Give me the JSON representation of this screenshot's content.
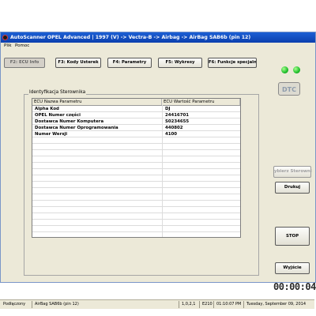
{
  "window": {
    "title": "AutoScanner OPEL Advanced | 1997 (V) -> Vectra-B -> Airbag -> AirBag SAB6b (pin 12)"
  },
  "menu": {
    "items": [
      "Plik",
      "Pomoc"
    ]
  },
  "toolbar": {
    "buttons": [
      {
        "label": "F2: ECU Info",
        "active": true
      },
      {
        "label": "F3: Kody Usterek",
        "active": false
      },
      {
        "label": "F4: Parametry",
        "active": false
      },
      {
        "label": "F5: Wykresy",
        "active": false
      },
      {
        "label": "F6: Funkcje specjalne",
        "active": false
      }
    ]
  },
  "indicators": {
    "led_color": "#1fbf2c",
    "dtc_label": "DTC"
  },
  "ecu_panel": {
    "group_title": "Identyfikacja Sterownika",
    "columns": [
      "ECU Nazwa Parametru",
      "ECU Wartość Parametru"
    ],
    "rows": [
      {
        "name": "Alpha Kod",
        "value": "DJ"
      },
      {
        "name": "OPEL Numer części",
        "value": "24416701"
      },
      {
        "name": "Dostawca Numer Komputera",
        "value": "S0234655"
      },
      {
        "name": "Dostawca Numer Oprogramowania",
        "value": "440802"
      },
      {
        "name": "Numer Wersji",
        "value": "4100"
      }
    ]
  },
  "side_buttons": {
    "select_ecu": "ybierz Sterowni",
    "print": "Drukuj",
    "stop": "STOP",
    "exit": "Wyjście"
  },
  "timer": "00:00:04",
  "statusbar": {
    "status": "Podłączony",
    "ecu": "AirBag SAB6b (pin 12)",
    "version": "1,0,2,1",
    "code": "E210",
    "time": "01:10:07 PM",
    "date": "Tuesday, September 09, 2014"
  }
}
